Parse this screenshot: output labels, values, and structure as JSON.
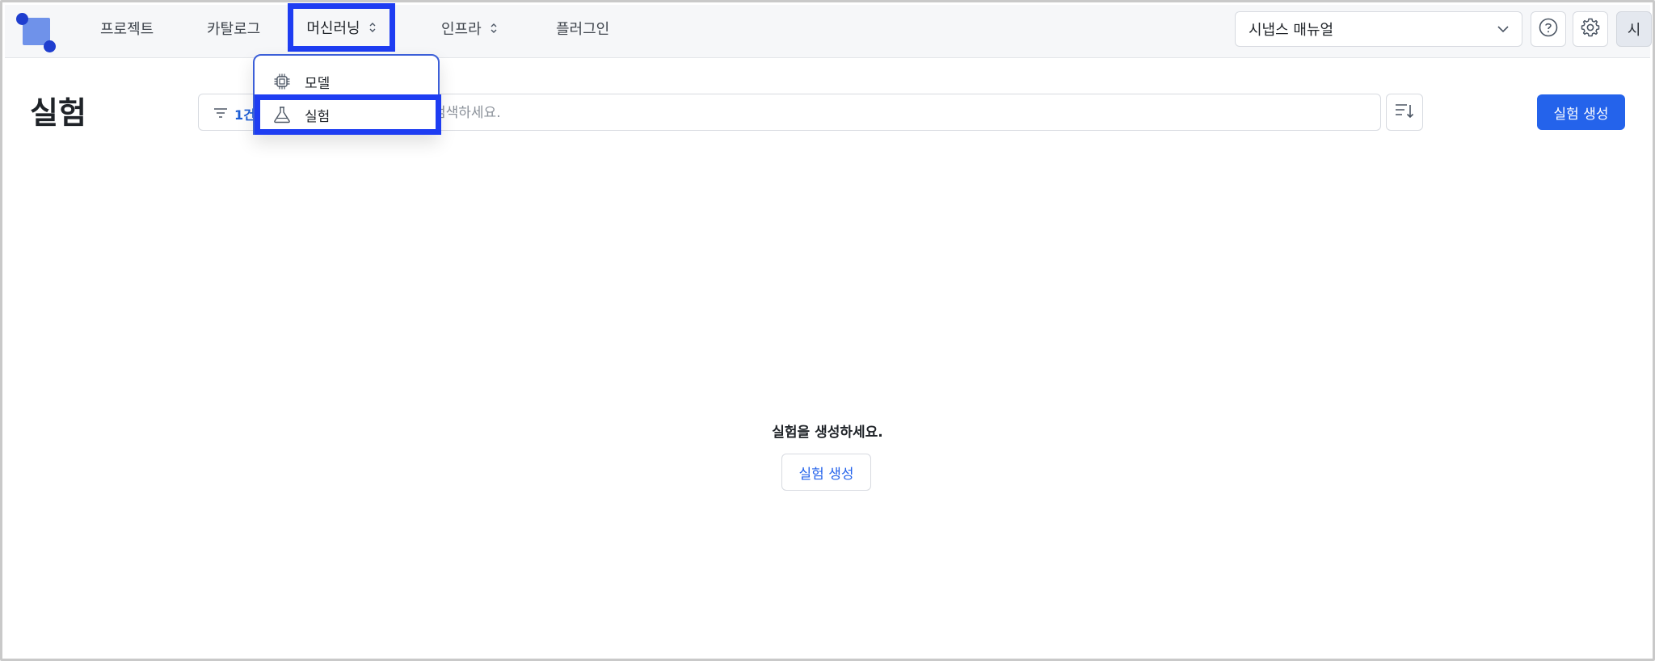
{
  "nav": {
    "items": [
      {
        "label": "프로젝트"
      },
      {
        "label": "카탈로그"
      },
      {
        "label": "머신러닝",
        "has_menu": true,
        "active": true
      },
      {
        "label": "인프라",
        "has_menu": true
      },
      {
        "label": "플러그인"
      }
    ],
    "workspace": "시냅스 매뉴얼",
    "help_icon": "question-circle-icon",
    "settings_icon": "gear-icon",
    "avatar_initial": "시"
  },
  "dropdown": {
    "items": [
      {
        "label": "모델",
        "icon": "chip-icon"
      },
      {
        "label": "실험",
        "icon": "flask-icon",
        "highlighted": true
      }
    ]
  },
  "page": {
    "title": "실험",
    "filter_label": "1건",
    "search_placeholder": "검색하세요.",
    "create_button": "실험 생성"
  },
  "empty_state": {
    "message": "실험을 생성하세요.",
    "button": "실험 생성"
  },
  "colors": {
    "accent": "#2463eb",
    "highlight_border": "#1e3df2",
    "logo": "#6f92ea"
  }
}
